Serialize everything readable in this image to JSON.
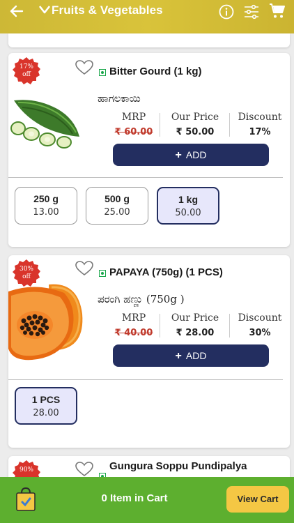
{
  "header": {
    "title": "Fruits & Vegetables",
    "icons": [
      "back-arrow-icon",
      "chevron-down-icon",
      "info-icon",
      "filter-icon",
      "cart-icon"
    ]
  },
  "products": [
    {
      "discount_badge_pct": "17%",
      "discount_badge_off": "off",
      "name": "Bitter Gourd (1 kg)",
      "local_name": "ಹಾಗಲಕಾಯಿ",
      "mrp_label": "MRP",
      "price_label": "Our Price",
      "discount_label": "Discount",
      "mrp": "₹ 60.00",
      "price": "₹ 50.00",
      "discount": "17%",
      "add_label": "ADD",
      "options": [
        {
          "weight": "250 g",
          "price": "13.00",
          "selected": false
        },
        {
          "weight": "500 g",
          "price": "25.00",
          "selected": false
        },
        {
          "weight": "1 kg",
          "price": "50.00",
          "selected": true
        }
      ]
    },
    {
      "discount_badge_pct": "30%",
      "discount_badge_off": "off",
      "name": "PAPAYA (750g) (1 PCS)",
      "local_name": "ಪರಂಗಿ ಹಣ್ಣು (750g )",
      "mrp_label": "MRP",
      "price_label": "Our Price",
      "discount_label": "Discount",
      "mrp": "₹ 40.00",
      "price": "₹ 28.00",
      "discount": "30%",
      "add_label": "ADD",
      "options": [
        {
          "weight": "1 PCS",
          "price": "28.00",
          "selected": true
        }
      ]
    },
    {
      "discount_badge_pct": "90%",
      "name": "Gungura Soppu Pundipalya"
    }
  ],
  "footer": {
    "cart_count_text": "0 Item in Cart",
    "view_cart_label": "View Cart"
  },
  "colors": {
    "header": "#d1bc36",
    "badge": "#d9342b",
    "add_button": "#232e60",
    "footer": "#5daf2f",
    "view_cart": "#f4c744",
    "veg_mark": "#19a64a"
  }
}
